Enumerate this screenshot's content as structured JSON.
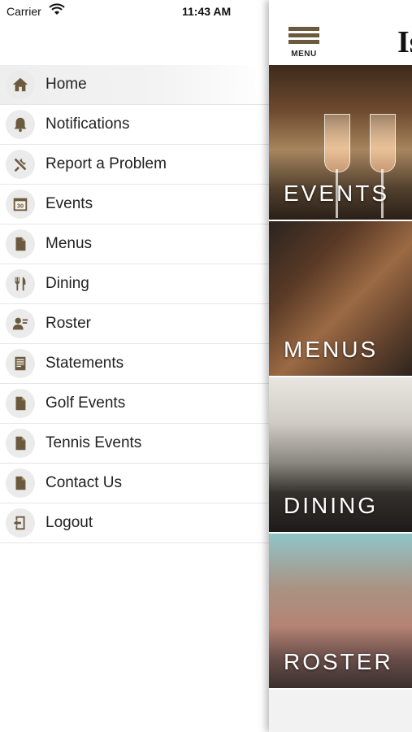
{
  "status": {
    "carrier": "Carrier",
    "time": "11:43 AM"
  },
  "header": {
    "menu_label": "MENU",
    "logo_fragment": "Is"
  },
  "drawer": {
    "items": [
      {
        "label": "Home",
        "icon": "home-icon"
      },
      {
        "label": "Notifications",
        "icon": "bell-icon"
      },
      {
        "label": "Report a Problem",
        "icon": "tools-icon"
      },
      {
        "label": "Events",
        "icon": "calendar-icon"
      },
      {
        "label": "Menus",
        "icon": "document-icon"
      },
      {
        "label": "Dining",
        "icon": "fork-knife-icon"
      },
      {
        "label": "Roster",
        "icon": "people-icon"
      },
      {
        "label": "Statements",
        "icon": "statement-icon"
      },
      {
        "label": "Golf Events",
        "icon": "document-icon"
      },
      {
        "label": "Tennis Events",
        "icon": "document-icon"
      },
      {
        "label": "Contact Us",
        "icon": "document-icon"
      },
      {
        "label": "Logout",
        "icon": "logout-icon"
      }
    ],
    "calendar_day": "30",
    "icon_color": "#6b5a3e",
    "active_item": "Home"
  },
  "tiles": [
    {
      "label": "EVENTS"
    },
    {
      "label": "MENUS"
    },
    {
      "label": "DINING"
    },
    {
      "label": "ROSTER"
    }
  ]
}
